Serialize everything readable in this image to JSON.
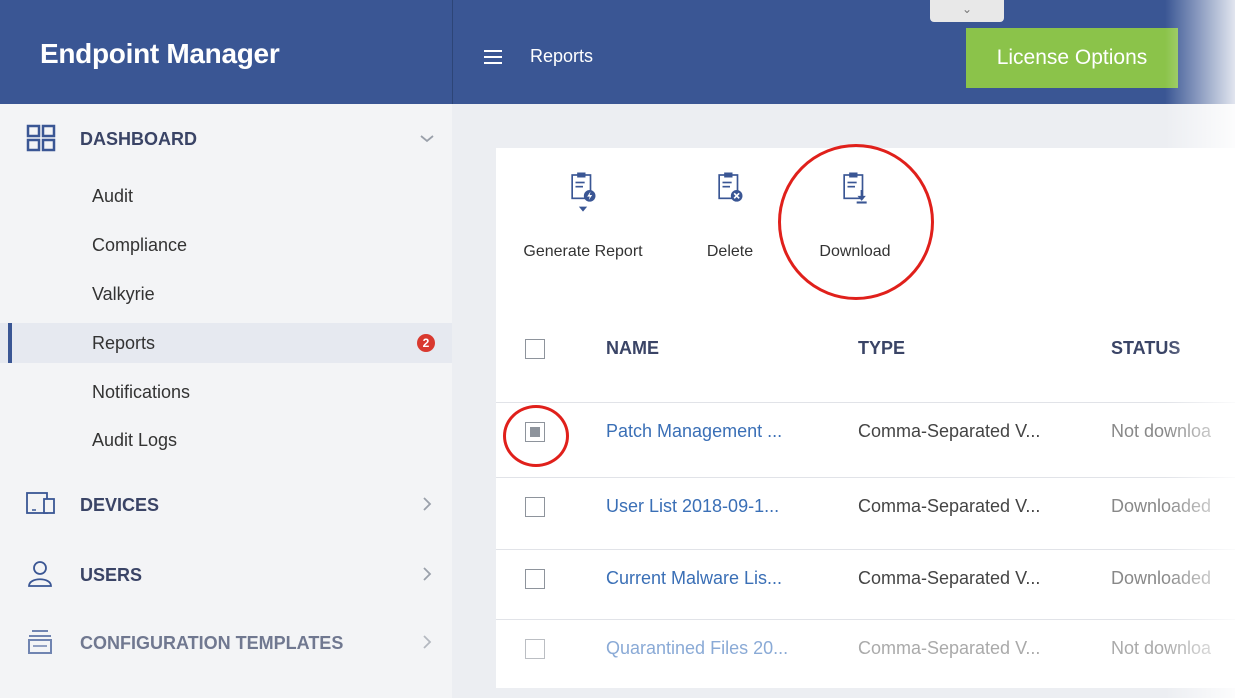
{
  "app": {
    "title": "Endpoint Manager"
  },
  "header": {
    "breadcrumb": "Reports",
    "license_button": "License Options",
    "handle": "⌄"
  },
  "sidebar": {
    "dashboard": {
      "label": "DASHBOARD",
      "items": [
        {
          "label": "Audit"
        },
        {
          "label": "Compliance"
        },
        {
          "label": "Valkyrie"
        },
        {
          "label": "Reports",
          "badge": "2"
        },
        {
          "label": "Notifications"
        },
        {
          "label": "Audit Logs"
        }
      ]
    },
    "devices": {
      "label": "DEVICES"
    },
    "users": {
      "label": "USERS"
    },
    "config": {
      "label": "CONFIGURATION TEMPLATES"
    }
  },
  "toolbar": {
    "generate": "Generate Report",
    "delete": "Delete",
    "download": "Download"
  },
  "table": {
    "headers": {
      "name": "NAME",
      "type": "TYPE",
      "status": "STATUS"
    },
    "rows": [
      {
        "name": "Patch Management ...",
        "type": "Comma-Separated V...",
        "status": "Not downloa",
        "checked": true
      },
      {
        "name": "User List 2018-09-1...",
        "type": "Comma-Separated V...",
        "status": "Downloaded",
        "checked": false
      },
      {
        "name": "Current Malware Lis...",
        "type": "Comma-Separated V...",
        "status": "Downloaded",
        "checked": false
      },
      {
        "name": "Quarantined Files 20...",
        "type": "Comma-Separated V...",
        "status": "Not downloa",
        "checked": false
      }
    ]
  },
  "colors": {
    "header": "#3a5694",
    "accent_green": "#8bc34a",
    "badge_red": "#d9392f",
    "annotation_red": "#e0201b",
    "link_blue": "#3a6fb6"
  }
}
